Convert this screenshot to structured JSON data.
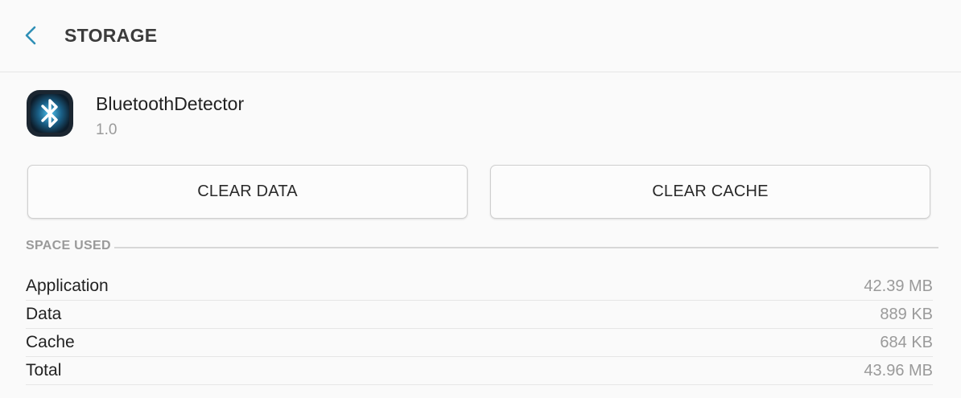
{
  "header": {
    "title": "STORAGE",
    "back_icon": "chevron-left-icon",
    "accent_color": "#2f8fb6"
  },
  "app": {
    "name": "BluetoothDetector",
    "version": "1.0",
    "icon": "bluetooth-icon"
  },
  "actions": {
    "clear_data_label": "CLEAR DATA",
    "clear_cache_label": "CLEAR CACHE"
  },
  "space_used": {
    "header": "SPACE USED",
    "rows": [
      {
        "label": "Application",
        "value": "42.39 MB"
      },
      {
        "label": "Data",
        "value": "889 KB"
      },
      {
        "label": "Cache",
        "value": "684 KB"
      },
      {
        "label": "Total",
        "value": "43.96 MB"
      }
    ]
  }
}
